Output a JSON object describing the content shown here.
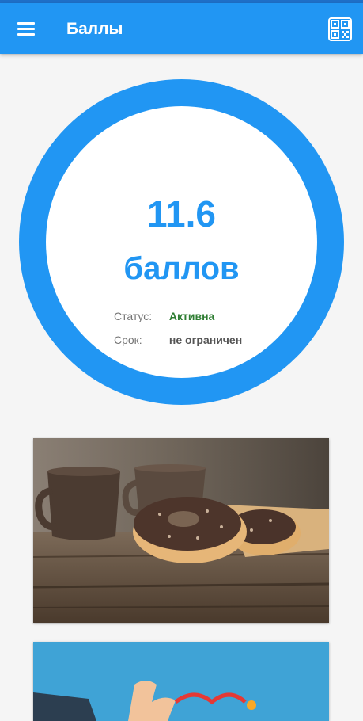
{
  "appbar": {
    "title": "Баллы",
    "menu_icon": "menu-icon",
    "qr_icon": "qr-code-icon",
    "color": "#2196f3"
  },
  "balance": {
    "points": "11.6",
    "unit": "баллов",
    "status_label": "Статус:",
    "status_value": "Активна",
    "status_color": "#2e7d32",
    "term_label": "Срок:",
    "term_value": "не ограничен"
  },
  "promos": [
    {
      "image": "coffee-cups-and-chocolate-donuts"
    },
    {
      "image": "blue-promo-banner-with-hand"
    }
  ]
}
